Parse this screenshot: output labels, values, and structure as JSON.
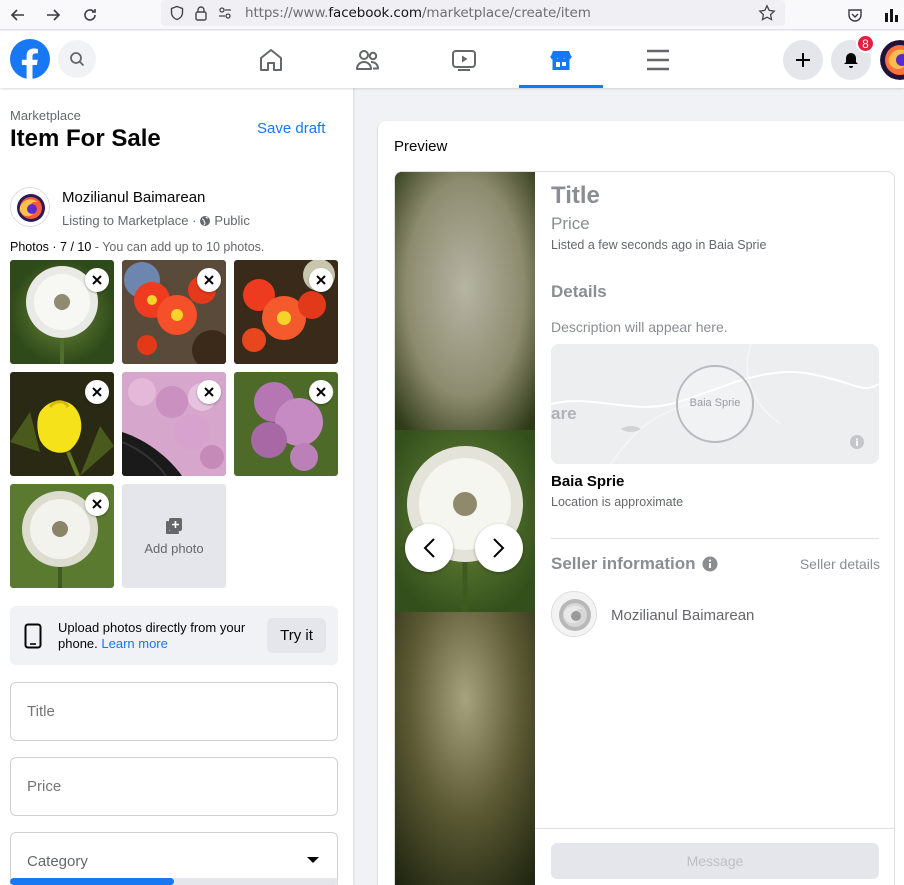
{
  "browser": {
    "url_prefix": "https://www.",
    "url_domain": "facebook.com",
    "url_path": "/marketplace/create/item"
  },
  "header": {
    "notification_count": "8",
    "colors": {
      "accent": "#1877f2",
      "badge": "#e41e3f"
    }
  },
  "left": {
    "breadcrumb": "Marketplace",
    "title": "Item For Sale",
    "save_draft": "Save draft",
    "seller_name": "Mozilianul Baimarean",
    "listing_info": "Listing to Marketplace · ",
    "audience": "Public",
    "photos_label": "Photos · 7 / 10",
    "photos_hint": " - You can add up to 10 photos.",
    "photos": [
      {
        "kind": "dandelion"
      },
      {
        "kind": "red-flowers"
      },
      {
        "kind": "red-flowers"
      },
      {
        "kind": "yellow-flower"
      },
      {
        "kind": "lilac"
      },
      {
        "kind": "lilac"
      },
      {
        "kind": "dandelion"
      }
    ],
    "add_photo": "Add photo",
    "upload_text": "Upload photos directly from your phone. ",
    "learn_more": "Learn more",
    "try_it": "Try it",
    "title_placeholder": "Title",
    "price_placeholder": "Price",
    "category_placeholder": "Category",
    "progress": 0.5
  },
  "preview": {
    "label": "Preview",
    "title": "Title",
    "price": "Price",
    "listed": "Listed a few seconds ago in Baia Sprie",
    "details_heading": "Details",
    "description": "Description will appear here.",
    "map_label": "Baia Sprie",
    "map_fragment": "are",
    "city": "Baia Sprie",
    "location_note": "Location is approximate",
    "seller_info": "Seller information",
    "seller_details": "Seller details",
    "seller_name": "Mozilianul Baimarean",
    "message": "Message"
  }
}
